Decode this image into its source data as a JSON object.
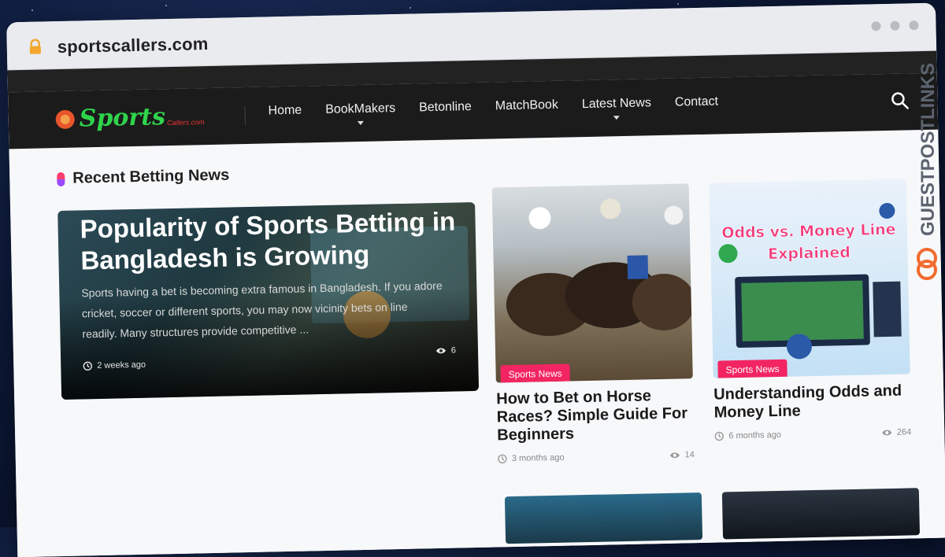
{
  "browser": {
    "url": "sportscallers.com"
  },
  "nav": {
    "logo_text": "Sports",
    "logo_sub": "Callers.com",
    "menu": [
      "Home",
      "BookMakers",
      "Betonline",
      "MatchBook",
      "Latest News",
      "Contact"
    ]
  },
  "section": {
    "title": "Recent Betting News"
  },
  "hero": {
    "title": "Popularity of Sports Betting in Bangladesh is Growing",
    "excerpt": "Sports having a bet is becoming extra famous in Bangladesh. If you adore cricket, soccer or different sports, you may now vicinity bets on line readily. Many structures provide competitive ...",
    "time": "2 weeks ago",
    "views": "6"
  },
  "cards": [
    {
      "badge": "Sports News",
      "title": "How to Bet on Horse Races? Simple Guide For Beginners",
      "time": "3 months ago",
      "views": "14"
    },
    {
      "badge": "Sports News",
      "image_text_1": "Odds vs. Money Line",
      "image_text_2": "Explained",
      "title": "Understanding Odds and Money Line",
      "time": "6 months ago",
      "views": "264"
    }
  ],
  "watermark": {
    "text": "GUESTPOSTLINKS"
  },
  "icons": {
    "lock": "lock-icon",
    "search": "search-icon",
    "clock": "clock-icon",
    "eye": "eye-icon"
  }
}
